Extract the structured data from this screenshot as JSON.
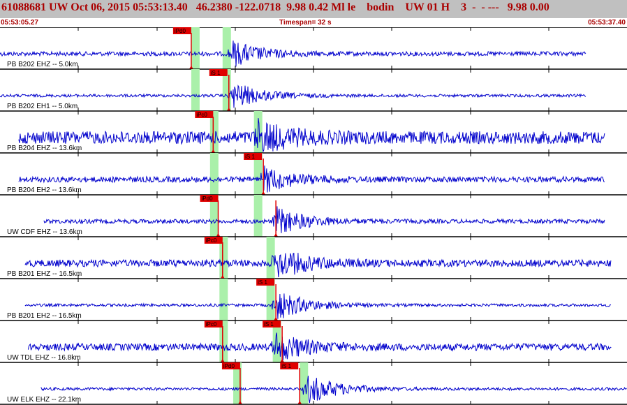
{
  "header": {
    "title": "61088681 UW Oct 06, 2015 05:53:13.40   46.2380 -122.0718  9.98 0.42 Ml le    bodin    UW 01 H    3  -  - ---   9.98 0.00",
    "start_time": "05:53:05.27",
    "timespan": "Timespan=  32 s",
    "end_time": "05:53:37.40"
  },
  "colors": {
    "trace": "#0000cc",
    "pick": "#e00000",
    "window": "#aaf0aa",
    "header_bg": "#c0c0c0",
    "header_text": "#aa0000"
  },
  "traces": [
    {
      "label": "PB B202 EHZ -- 5.0km",
      "p_label": "iPd0",
      "p_pos": 0.305,
      "s_label": "",
      "s_pos": null,
      "windows": [
        0.305,
        0.355
      ],
      "data_start": 0.0,
      "data_end": 0.935,
      "amp": 3,
      "burst": 0.37,
      "burst_amp": 18,
      "noise": 1
    },
    {
      "label": "PB B202 EH1 -- 5.0km",
      "p_label": "",
      "p_pos": null,
      "s_label": "iS 1",
      "s_pos": 0.365,
      "windows": [
        0.305,
        0.355
      ],
      "data_start": 0.0,
      "data_end": 0.935,
      "amp": 2,
      "burst": 0.37,
      "burst_amp": 20,
      "noise": 1
    },
    {
      "label": "PB B204 EHZ -- 13.6km",
      "p_label": "iPc0",
      "p_pos": 0.34,
      "s_label": "",
      "s_pos": null,
      "windows": [
        0.335,
        0.405
      ],
      "data_start": 0.03,
      "data_end": 0.965,
      "amp": 9,
      "burst": 0.41,
      "burst_amp": 22,
      "noise": 1
    },
    {
      "label": "PB B204 EH2 -- 13.6km",
      "p_label": "",
      "p_pos": null,
      "s_label": "iS 1",
      "s_pos": 0.42,
      "windows": [
        0.335,
        0.405
      ],
      "data_start": 0.03,
      "data_end": 0.965,
      "amp": 4,
      "burst": 0.42,
      "burst_amp": 18,
      "noise": 1
    },
    {
      "label": "UW CDF EHZ -- 13.6km",
      "p_label": "iPd0",
      "p_pos": 0.348,
      "s_label": "",
      "s_pos": 0.44,
      "windows": [
        0.335,
        0.405
      ],
      "data_start": 0.07,
      "data_end": 0.965,
      "amp": 3,
      "burst": 0.44,
      "burst_amp": 20,
      "noise": 1
    },
    {
      "label": "PB B201 EHZ -- 16.5km",
      "p_label": "iPc0",
      "p_pos": 0.355,
      "s_label": "",
      "s_pos": null,
      "windows": [
        0.35,
        0.425
      ],
      "data_start": 0.04,
      "data_end": 0.975,
      "amp": 5,
      "burst": 0.44,
      "burst_amp": 22,
      "noise": 1
    },
    {
      "label": "PB B201 EH2 -- 16.5km",
      "p_label": "",
      "p_pos": null,
      "s_label": "iS 1",
      "s_pos": 0.44,
      "windows": [
        0.35,
        0.425
      ],
      "data_start": 0.04,
      "data_end": 0.975,
      "amp": 2,
      "burst": 0.44,
      "burst_amp": 22,
      "noise": 1
    },
    {
      "label": "UW TDL EHZ -- 16.8km",
      "p_label": "iPc0",
      "p_pos": 0.355,
      "s_label": "iS 1",
      "s_pos": 0.45,
      "windows": [
        0.35,
        0.435
      ],
      "data_start": 0.045,
      "data_end": 0.975,
      "amp": 5,
      "burst": 0.44,
      "burst_amp": 20,
      "noise": 1
    },
    {
      "label": "UW ELK EHZ -- 22.1km",
      "p_label": "iPd0",
      "p_pos": 0.383,
      "s_label": "iS 1",
      "s_pos": 0.478,
      "windows": [
        0.372,
        0.478
      ],
      "data_start": 0.065,
      "data_end": 1.0,
      "amp": 2,
      "burst": 0.49,
      "burst_amp": 22,
      "noise": 1
    }
  ]
}
